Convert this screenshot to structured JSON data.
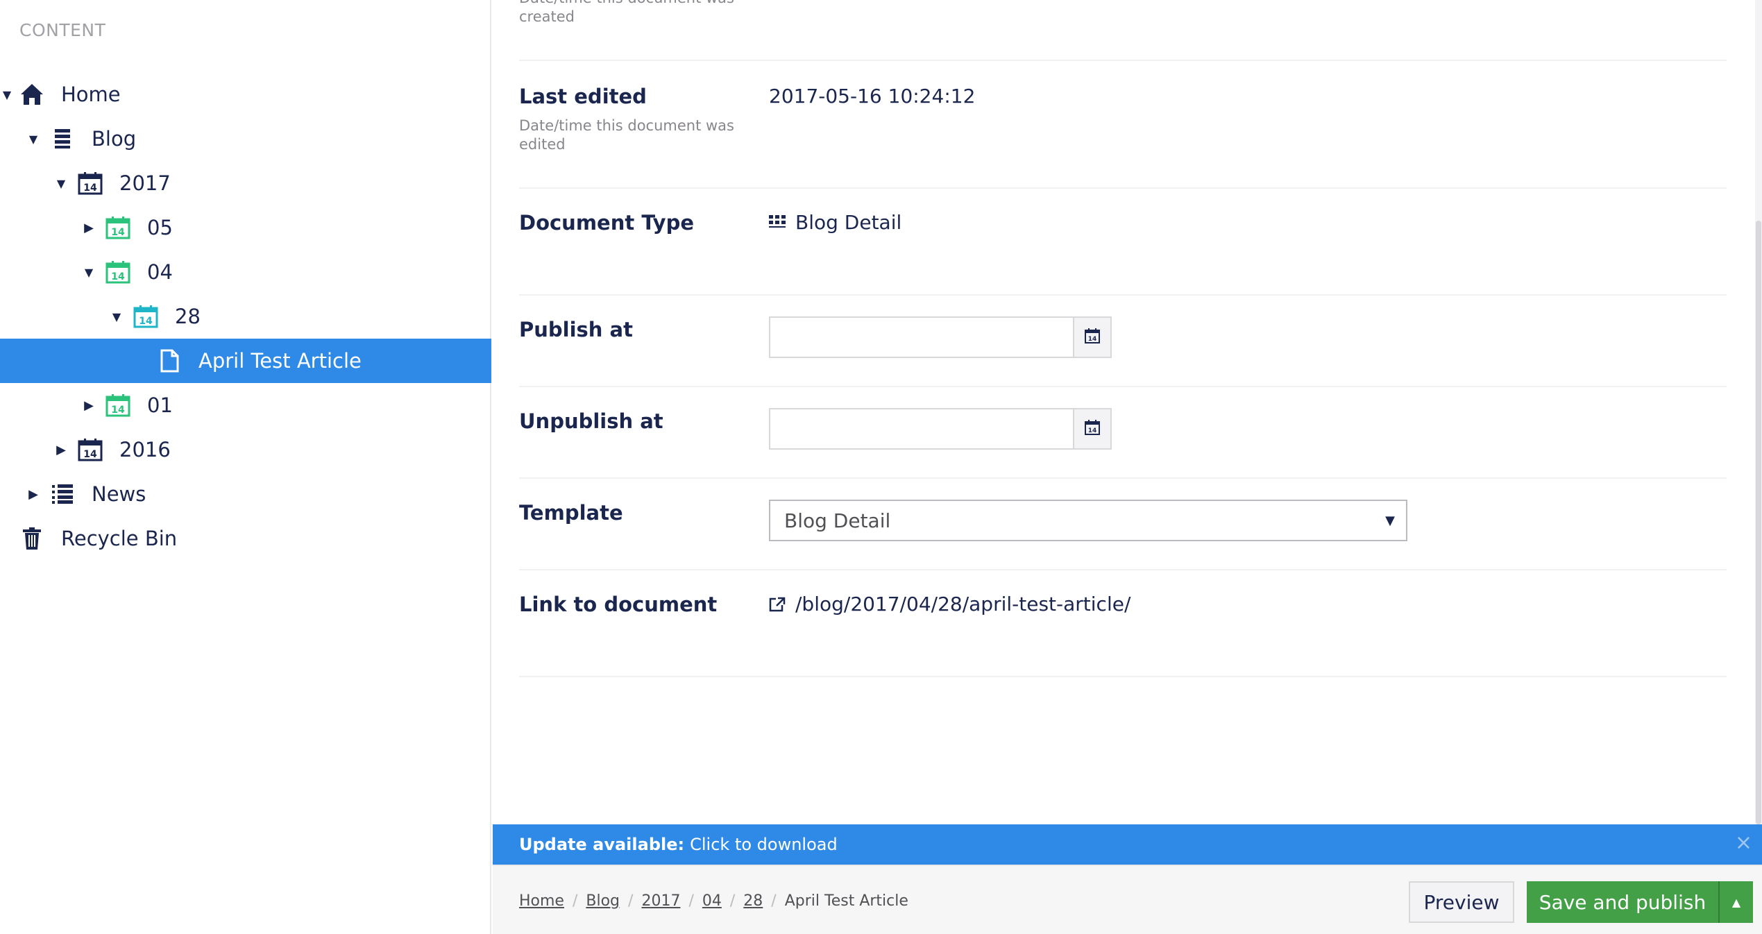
{
  "sidebar": {
    "heading": "CONTENT",
    "items": [
      {
        "label": "Home"
      },
      {
        "label": "Blog"
      },
      {
        "label": "2017"
      },
      {
        "label": "05"
      },
      {
        "label": "04"
      },
      {
        "label": "28"
      },
      {
        "label": "April Test Article"
      },
      {
        "label": "01"
      },
      {
        "label": "2016"
      },
      {
        "label": "News"
      },
      {
        "label": "Recycle Bin"
      }
    ]
  },
  "properties": {
    "created_desc": "Date/time this document was created",
    "last_edited": {
      "label": "Last edited",
      "desc": "Date/time this document was edited",
      "value": "2017-05-16 10:24:12"
    },
    "document_type": {
      "label": "Document Type",
      "value": "Blog Detail"
    },
    "publish_at": {
      "label": "Publish at",
      "value": ""
    },
    "unpublish_at": {
      "label": "Unpublish at",
      "value": ""
    },
    "template": {
      "label": "Template",
      "value": "Blog Detail"
    },
    "link": {
      "label": "Link to document",
      "value": "/blog/2017/04/28/april-test-article/"
    }
  },
  "update_bar": {
    "bold": "Update available:",
    "text": "Click to download",
    "close": "×"
  },
  "breadcrumb": {
    "items": [
      "Home",
      "Blog",
      "2017",
      "04",
      "28"
    ],
    "current": "April Test Article",
    "separator": "/"
  },
  "buttons": {
    "preview": "Preview",
    "save_publish": "Save and publish"
  },
  "colors": {
    "accent": "#2e8ae6",
    "publish": "#43a047",
    "date_icon_green": "#2bc37c",
    "date_icon_cyan": "#1fb5c9"
  }
}
